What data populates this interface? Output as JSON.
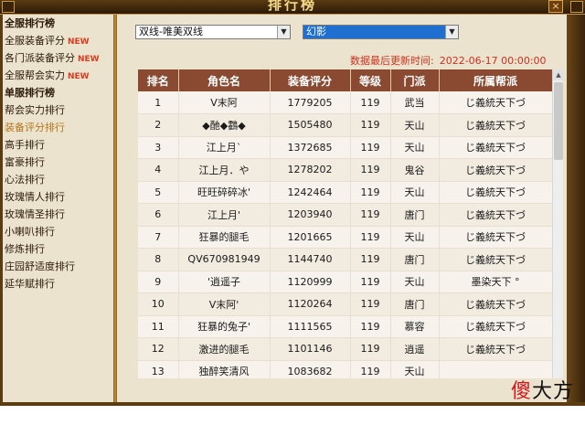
{
  "window": {
    "title": "排行榜",
    "close_label": "×"
  },
  "sidebar": {
    "items": [
      {
        "label": "全服排行榜",
        "type": "header",
        "new": ""
      },
      {
        "label": "全服装备评分",
        "type": "item",
        "new": "NEW"
      },
      {
        "label": "各门派装备评分",
        "type": "item",
        "new": "NEW"
      },
      {
        "label": "全服帮会实力",
        "type": "item",
        "new": "NEW"
      },
      {
        "label": "单服排行榜",
        "type": "header",
        "new": ""
      },
      {
        "label": "帮会实力排行",
        "type": "item",
        "new": ""
      },
      {
        "label": "装备评分排行",
        "type": "active",
        "new": ""
      },
      {
        "label": "高手排行",
        "type": "item",
        "new": ""
      },
      {
        "label": "富豪排行",
        "type": "item",
        "new": ""
      },
      {
        "label": "心法排行",
        "type": "item",
        "new": ""
      },
      {
        "label": "玫瑰情人排行",
        "type": "item",
        "new": ""
      },
      {
        "label": "玫瑰情圣排行",
        "type": "item",
        "new": ""
      },
      {
        "label": "小喇叭排行",
        "type": "item",
        "new": ""
      },
      {
        "label": "修炼排行",
        "type": "item",
        "new": ""
      },
      {
        "label": "庄园舒适度排行",
        "type": "item",
        "new": ""
      },
      {
        "label": "延华赋排行",
        "type": "item",
        "new": ""
      }
    ]
  },
  "filters": {
    "server": "双线-唯美双线",
    "realm": "幻影"
  },
  "update": {
    "label": "数据最后更新时间:",
    "time": "2022-06-17 00:00:00"
  },
  "table": {
    "headers": [
      "排名",
      "角色名",
      "装备评分",
      "等级",
      "门派",
      "所属帮派"
    ],
    "rows": [
      [
        "1",
        "V末阿",
        "1779205",
        "119",
        "武当",
        "じ義統天下づ"
      ],
      [
        "2",
        "◆酏◆鸖◆",
        "1505480",
        "119",
        "天山",
        "じ義統天下づ"
      ],
      [
        "3",
        "江上月`",
        "1372685",
        "119",
        "天山",
        "じ義統天下づ"
      ],
      [
        "4",
        "江上月．や",
        "1278202",
        "119",
        "鬼谷",
        "じ義統天下づ"
      ],
      [
        "5",
        "旺旺碎碎冰'",
        "1242464",
        "119",
        "天山",
        "じ義統天下づ"
      ],
      [
        "6",
        "江上月'",
        "1203940",
        "119",
        "唐门",
        "じ義統天下づ"
      ],
      [
        "7",
        "狂暴的腿毛",
        "1201665",
        "119",
        "天山",
        "じ義統天下づ"
      ],
      [
        "8",
        "QV670981949",
        "1144740",
        "119",
        "唐门",
        "じ義統天下づ"
      ],
      [
        "9",
        "'逍遥子",
        "1120999",
        "119",
        "天山",
        "墨染天下 °"
      ],
      [
        "10",
        "V末阿'",
        "1120264",
        "119",
        "唐门",
        "じ義統天下づ"
      ],
      [
        "11",
        "狂暴的兔子'",
        "1111565",
        "119",
        "慕容",
        "じ義統天下づ"
      ],
      [
        "12",
        "激进的腿毛",
        "1101146",
        "119",
        "逍遥",
        "じ義統天下づ"
      ],
      [
        "13",
        "独醉笑清风",
        "1083682",
        "119",
        "天山",
        ""
      ]
    ]
  },
  "watermark": {
    "first": "傻",
    "rest": "大方"
  },
  "colors": {
    "header_bg": "#8a4a31",
    "accent_red": "#d0321e",
    "active": "#b4761c",
    "frame": "#5a3b12"
  }
}
